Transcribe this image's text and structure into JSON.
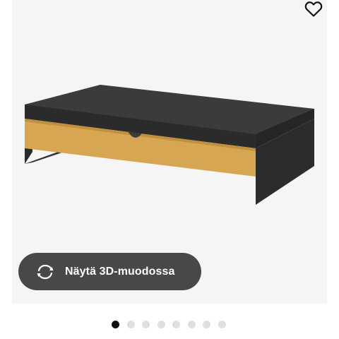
{
  "view_3d_button": {
    "label": "Näytä 3D-muodossa",
    "icon": "rotate-360-icon"
  },
  "favourite": {
    "icon": "heart-icon"
  },
  "carousel": {
    "total_images": 8,
    "active_index": 0
  },
  "colors": {
    "button_background": "#484848",
    "active_dot": "#111111",
    "inactive_dot": "#dfdfdf"
  }
}
